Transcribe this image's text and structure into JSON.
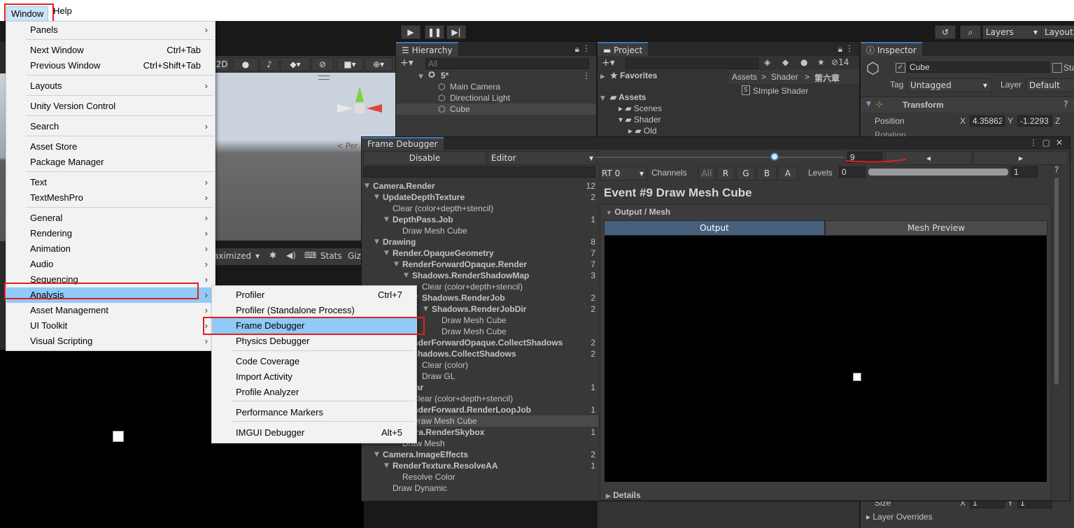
{
  "menubar": {
    "window": "Window",
    "help": "Help"
  },
  "toolbar": {
    "layers": "Layers",
    "layout": "Layout"
  },
  "window_menu": [
    {
      "label": "Panels",
      "arrow": true
    },
    {
      "label": "Next Window",
      "shortcut": "Ctrl+Tab"
    },
    {
      "label": "Previous Window",
      "shortcut": "Ctrl+Shift+Tab"
    },
    {
      "label": "Layouts",
      "arrow": true
    },
    {
      "label": "Unity Version Control"
    },
    {
      "label": "Search",
      "arrow": true
    },
    {
      "label": "Asset Store"
    },
    {
      "label": "Package Manager"
    },
    {
      "label": "Text",
      "arrow": true
    },
    {
      "label": "TextMeshPro",
      "arrow": true
    },
    {
      "label": "General",
      "arrow": true
    },
    {
      "label": "Rendering",
      "arrow": true
    },
    {
      "label": "Animation",
      "arrow": true
    },
    {
      "label": "Audio",
      "arrow": true
    },
    {
      "label": "Sequencing",
      "arrow": true
    },
    {
      "label": "Analysis",
      "arrow": true
    },
    {
      "label": "Asset Management",
      "arrow": true
    },
    {
      "label": "UI Toolkit",
      "arrow": true
    },
    {
      "label": "Visual Scripting",
      "arrow": true
    }
  ],
  "analysis_menu": [
    {
      "label": "Profiler",
      "shortcut": "Ctrl+7"
    },
    {
      "label": "Profiler (Standalone Process)"
    },
    {
      "label": "Frame Debugger"
    },
    {
      "label": "Physics Debugger"
    },
    {
      "label": "Code Coverage"
    },
    {
      "label": "Import Activity"
    },
    {
      "label": "Profile Analyzer"
    },
    {
      "label": "Performance Markers"
    },
    {
      "label": "IMGUI Debugger",
      "shortcut": "Alt+5"
    }
  ],
  "scene": {
    "mode_2d": "2D",
    "persp": "< Per"
  },
  "game_toolbar": {
    "maximized": "aximized",
    "stats": "Stats",
    "gizmos": "Giz"
  },
  "hierarchy": {
    "tab": "Hierarchy",
    "search_placeholder": "All",
    "scene": "5*",
    "items": [
      "Main Camera",
      "Directional Light",
      "Cube"
    ]
  },
  "project": {
    "tab": "Project",
    "hidden_count": "14",
    "favorites": "Favorites",
    "assets": "Assets",
    "folders": [
      "Scenes",
      "Shader",
      "Old"
    ],
    "breadcrumb": [
      "Assets",
      "Shader",
      "第六章"
    ],
    "file": "SImple Shader"
  },
  "inspector": {
    "tab": "Inspector",
    "name": "Cube",
    "static": "Sta",
    "tag_label": "Tag",
    "tag_value": "Untagged",
    "layer_label": "Layer",
    "layer_value": "Default",
    "transform": "Transform",
    "position_label": "Position",
    "pos_x": "4.35862",
    "pos_y": "-1.2293",
    "rotation_label": "Rotation",
    "size_label": "Size",
    "size_x": "1",
    "size_y": "1",
    "layer_overrides": "Layer Overrides"
  },
  "frame_debugger": {
    "title": "Frame Debugger",
    "disable": "Disable",
    "target": "Editor",
    "event_index": "9",
    "rt": "RT 0",
    "channels": "Channels",
    "ch_all": "All",
    "ch_r": "R",
    "ch_g": "G",
    "ch_b": "B",
    "ch_a": "A",
    "levels_label": "Levels",
    "levels_min": "0",
    "levels_max": "1",
    "event_title": "Event #9 Draw Mesh Cube",
    "output_mesh": "Output / Mesh",
    "tab_output": "Output",
    "tab_mesh_preview": "Mesh Preview",
    "details": "Details",
    "tree": [
      {
        "label": "Camera.Render",
        "count": "12",
        "bold": true,
        "indent": 0,
        "arrow": true
      },
      {
        "label": "UpdateDepthTexture",
        "count": "2",
        "bold": true,
        "indent": 1,
        "arrow": true
      },
      {
        "label": "Clear (color+depth+stencil)",
        "count": "",
        "bold": false,
        "indent": 2,
        "arrow": false
      },
      {
        "label": "DepthPass.Job",
        "count": "1",
        "bold": true,
        "indent": 2,
        "arrow": true
      },
      {
        "label": "Draw Mesh Cube",
        "count": "",
        "bold": false,
        "indent": 3,
        "arrow": false
      },
      {
        "label": "Drawing",
        "count": "8",
        "bold": true,
        "indent": 1,
        "arrow": true
      },
      {
        "label": "Render.OpaqueGeometry",
        "count": "7",
        "bold": true,
        "indent": 2,
        "arrow": true
      },
      {
        "label": "RenderForwardOpaque.Render",
        "count": "7",
        "bold": true,
        "indent": 3,
        "arrow": true
      },
      {
        "label": "Shadows.RenderShadowMap",
        "count": "3",
        "bold": true,
        "indent": 4,
        "arrow": true
      },
      {
        "label": "Clear (color+depth+stencil)",
        "count": "",
        "bold": false,
        "indent": 5,
        "arrow": false
      },
      {
        "label": "Shadows.RenderJob",
        "count": "2",
        "bold": true,
        "indent": 5,
        "arrow": true
      },
      {
        "label": "Shadows.RenderJobDir",
        "count": "2",
        "bold": true,
        "indent": 6,
        "arrow": true
      },
      {
        "label": "Draw Mesh Cube",
        "count": "",
        "bold": false,
        "indent": 7,
        "arrow": false
      },
      {
        "label": "Draw Mesh Cube",
        "count": "",
        "bold": false,
        "indent": 7,
        "arrow": false
      },
      {
        "label": "RenderForwardOpaque.CollectShadows",
        "count": "2",
        "bold": true,
        "indent": 3,
        "arrow": true
      },
      {
        "label": "Shadows.CollectShadows",
        "count": "2",
        "bold": true,
        "indent": 4,
        "arrow": true
      },
      {
        "label": "Clear (color)",
        "count": "",
        "bold": false,
        "indent": 5,
        "arrow": false
      },
      {
        "label": "Draw GL",
        "count": "",
        "bold": false,
        "indent": 5,
        "arrow": false
      },
      {
        "label": "Clear",
        "count": "1",
        "bold": true,
        "indent": 3,
        "arrow": true
      },
      {
        "label": "Clear (color+depth+stencil)",
        "count": "",
        "bold": false,
        "indent": 4,
        "arrow": false
      },
      {
        "label": "RenderForward.RenderLoopJob",
        "count": "1",
        "bold": true,
        "indent": 3,
        "arrow": true
      },
      {
        "label": "Draw Mesh Cube",
        "count": "",
        "bold": false,
        "indent": 4,
        "arrow": false,
        "selected": true
      },
      {
        "label": "Camera.RenderSkybox",
        "count": "1",
        "bold": true,
        "indent": 2,
        "arrow": true
      },
      {
        "label": "Draw Mesh",
        "count": "",
        "bold": false,
        "indent": 3,
        "arrow": false
      },
      {
        "label": "Camera.ImageEffects",
        "count": "2",
        "bold": true,
        "indent": 1,
        "arrow": true
      },
      {
        "label": "RenderTexture.ResolveAA",
        "count": "1",
        "bold": true,
        "indent": 2,
        "arrow": true
      },
      {
        "label": "Resolve Color",
        "count": "",
        "bold": false,
        "indent": 3,
        "arrow": false
      },
      {
        "label": "Draw Dynamic",
        "count": "",
        "bold": false,
        "indent": 2,
        "arrow": false
      }
    ]
  }
}
